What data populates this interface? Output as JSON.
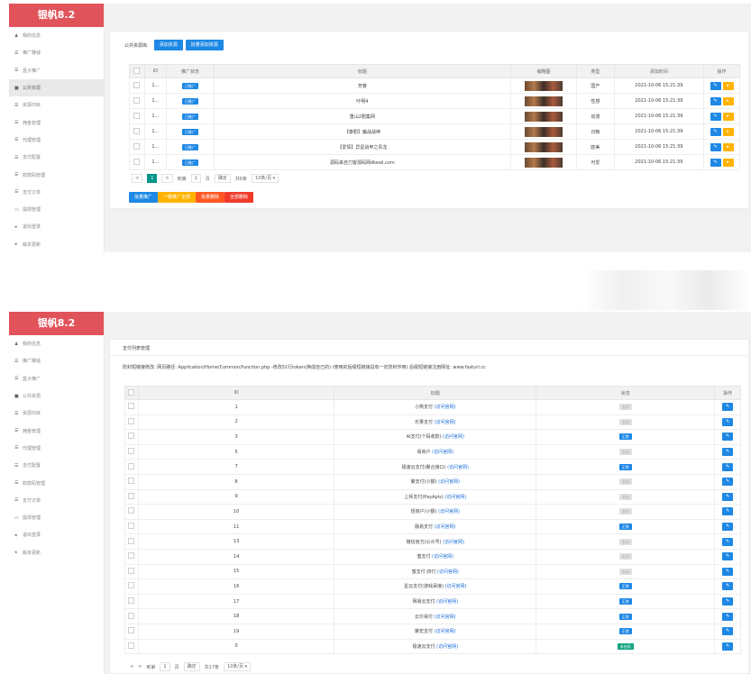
{
  "shot1": {
    "brand": "银帆8.2",
    "menu": [
      {
        "icon": "user-icon",
        "glyph": "♟",
        "label": "我的信息"
      },
      {
        "icon": "list-icon",
        "glyph": "☰",
        "label": "推广赚钱"
      },
      {
        "icon": "list-icon",
        "glyph": "☰",
        "label": "盒子推广"
      },
      {
        "icon": "video-icon",
        "glyph": "■",
        "label": "公共资源",
        "active": true
      },
      {
        "icon": "list-icon",
        "glyph": "☰",
        "label": "资源归目"
      },
      {
        "icon": "list-icon",
        "glyph": "☰",
        "label": "佣金管理"
      },
      {
        "icon": "list-icon",
        "glyph": "☰",
        "label": "代理管理"
      },
      {
        "icon": "list-icon",
        "glyph": "☰",
        "label": "支付配置"
      },
      {
        "icon": "list-icon",
        "glyph": "☰",
        "label": "收款码管理"
      },
      {
        "icon": "list-icon",
        "glyph": "☰",
        "label": "支付订单"
      },
      {
        "icon": "card-icon",
        "glyph": "▭",
        "label": "提现管理"
      },
      {
        "icon": "logout-icon",
        "glyph": "◂",
        "label": "退出登录"
      },
      {
        "icon": "update-icon",
        "glyph": "◂",
        "label": "版本更新"
      }
    ],
    "toolbar": {
      "label": "公共资源库:",
      "add": "添加资源",
      "batch_add": "批量添加资源"
    },
    "headers": [
      "",
      "ID",
      "推广状态",
      "标题",
      "缩略图",
      "类型",
      "添加时间",
      "操作"
    ],
    "rows": [
      {
        "id": "1...",
        "status": "已推广",
        "title": "芳春",
        "type": "国产",
        "time": "2021-10-06 15:21:39"
      },
      {
        "id": "1...",
        "status": "已推广",
        "title": "叶明4",
        "type": "性感",
        "time": "2021-10-06 15:21:39"
      },
      {
        "id": "1...",
        "status": "已推广",
        "title": "重山2剧集网",
        "type": "动漫",
        "time": "2021-10-06 15:21:39"
      },
      {
        "id": "1...",
        "status": "已推广",
        "title": "【泰剧】魔战战神",
        "type": "日韩",
        "time": "2021-10-06 15:21:39"
      },
      {
        "id": "1...",
        "status": "已推广",
        "title": "【爱情】异星战甲之青龙",
        "type": "欧美",
        "time": "2021-10-06 15:21:39"
      },
      {
        "id": "1...",
        "status": "已推广",
        "title": "源码来自刀客源码网dkewl.com",
        "type": "可爱",
        "time": "2021-10-06 15:21:39"
      }
    ],
    "pager": {
      "prev": "<",
      "page": "1",
      "next": ">",
      "goto": "到第",
      "page_input": "1",
      "page_unit": "页",
      "confirm": "确定",
      "total": "共6条",
      "per_page": "10条/页 ▾"
    },
    "bottom_buttons": [
      "批量推广",
      "一键推广全部",
      "批量删除",
      "全部删除"
    ]
  },
  "shot2": {
    "brand": "银帆8.2",
    "menu": [
      {
        "icon": "user-icon",
        "glyph": "♟",
        "label": "我的信息"
      },
      {
        "icon": "list-icon",
        "glyph": "☰",
        "label": "推广赚钱"
      },
      {
        "icon": "list-icon",
        "glyph": "☰",
        "label": "盒子推广"
      },
      {
        "icon": "video-icon",
        "glyph": "■",
        "label": "公共资源"
      },
      {
        "icon": "list-icon",
        "glyph": "☰",
        "label": "资源归目"
      },
      {
        "icon": "list-icon",
        "glyph": "☰",
        "label": "佣金管理"
      },
      {
        "icon": "list-icon",
        "glyph": "☰",
        "label": "代理管理"
      },
      {
        "icon": "list-icon",
        "glyph": "☰",
        "label": "支付配置"
      },
      {
        "icon": "list-icon",
        "glyph": "☰",
        "label": "收款码管理"
      },
      {
        "icon": "list-icon",
        "glyph": "☰",
        "label": "支付订单"
      },
      {
        "icon": "card-icon",
        "glyph": "▭",
        "label": "提现管理"
      },
      {
        "icon": "logout-icon",
        "glyph": "◂",
        "label": "退出登录"
      },
      {
        "icon": "update-icon",
        "glyph": "◂",
        "label": "版本更新"
      }
    ],
    "title": "支付列表管理",
    "notice": "防封短链接修改: 网页路径: Application/Home/Common/function.php -修改51行token(换成自己的) (使用的后缀短链接具有一定防封作用)  后缀短链接注册网址: www.fasturl.cc",
    "headers": [
      "",
      "ID",
      "标题",
      "状态",
      "操作"
    ],
    "rows": [
      {
        "id": "1",
        "name": "小熊支付",
        "link": "(访问官网)",
        "status": "关闭",
        "kind": "grey"
      },
      {
        "id": "2",
        "name": "乐果支付",
        "link": "(访问官网)",
        "status": "关闭",
        "kind": "grey"
      },
      {
        "id": "3",
        "name": "AI支付(个码收款)",
        "link": "(访问官网)",
        "status": "正常",
        "kind": "blue"
      },
      {
        "id": "5",
        "name": "易商户",
        "link": "(访问官网)",
        "status": "关闭",
        "kind": "grey"
      },
      {
        "id": "7",
        "name": "极速云支付(聚合接口)",
        "link": "(访问官网)",
        "status": "正常",
        "kind": "blue"
      },
      {
        "id": "8",
        "name": "聚支付(小额)",
        "link": "(访问官网)",
        "status": "关闭",
        "kind": "grey"
      },
      {
        "id": "9",
        "name": "上师支付(PayApis)",
        "link": "(访问官网)",
        "status": "关闭",
        "kind": "grey"
      },
      {
        "id": "10",
        "name": "轻商户(小额)",
        "link": "(访问官网)",
        "status": "关闭",
        "kind": "grey"
      },
      {
        "id": "11",
        "name": "融易支付",
        "link": "(访问官网)",
        "status": "正常",
        "kind": "blue"
      },
      {
        "id": "13",
        "name": "微信官方(公众号)",
        "link": "(访问官网)",
        "status": "关闭",
        "kind": "grey"
      },
      {
        "id": "14",
        "name": "蜜支付",
        "link": "(访问官网)",
        "status": "关闭",
        "kind": "grey"
      },
      {
        "id": "15",
        "name": "蜜支付 四付",
        "link": "(访问官网)",
        "status": "关闭",
        "kind": "grey"
      },
      {
        "id": "16",
        "name": "星云支付(游戏承接)",
        "link": "(访问官网)",
        "status": "正常",
        "kind": "blue"
      },
      {
        "id": "17",
        "name": "网易云支付",
        "link": "(访问官网)",
        "status": "正常",
        "kind": "blue"
      },
      {
        "id": "18",
        "name": "云尔易付",
        "link": "(访问官网)",
        "status": "正常",
        "kind": "blue"
      },
      {
        "id": "19",
        "name": "聚宏支付",
        "link": "(访问官网)",
        "status": "正常",
        "kind": "blue"
      },
      {
        "id": "0",
        "name": "极速云支付",
        "link": "(访问官网)",
        "status": "未启用",
        "kind": "green"
      }
    ],
    "pager": {
      "prev": "<",
      "next": ">",
      "goto": "到第",
      "page_input": "1",
      "page_unit": "页",
      "confirm": "确定",
      "total": "共17条",
      "per_page": "10条/页 ▾"
    }
  }
}
